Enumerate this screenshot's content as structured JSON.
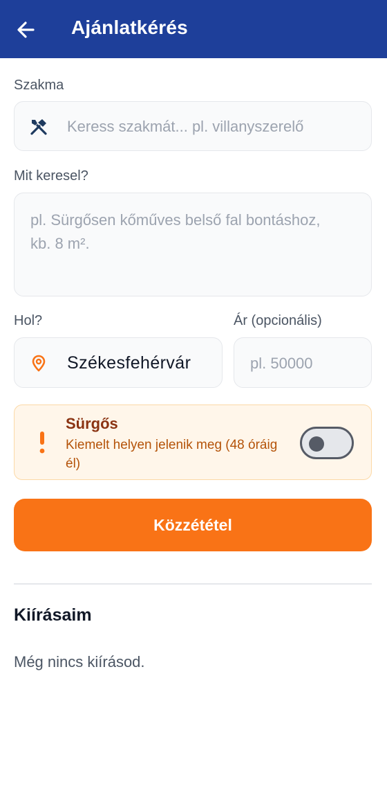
{
  "header": {
    "title": "Ajánlatkérés",
    "back_icon": "arrow-left-icon"
  },
  "form": {
    "trade": {
      "label": "Szakma",
      "placeholder": "Keress szakmát... pl. villanyszerelő",
      "icon": "tools-icon"
    },
    "need": {
      "label": "Mit keresel?",
      "placeholder": "pl. Sürgősen kőműves belső fal bontáshoz, kb. 8 m²."
    },
    "location": {
      "label": "Hol?",
      "value": "Székesfehérvár",
      "icon": "location-pin-icon"
    },
    "price": {
      "label": "Ár (opcionális)",
      "placeholder": "pl. 50000"
    },
    "urgent": {
      "title": "Sürgős",
      "description": "Kiemelt helyen jelenik meg (48 óráig él)",
      "enabled": false,
      "icon": "exclamation-icon"
    },
    "submit_label": "Közzététel"
  },
  "my_posts": {
    "title": "Kiírásaim",
    "empty_text": "Még nincs kiírásod."
  },
  "colors": {
    "primary": "#1e3f9a",
    "accent": "#f97316",
    "urgent_bg": "#fff6ea",
    "urgent_text": "#8a3312"
  }
}
